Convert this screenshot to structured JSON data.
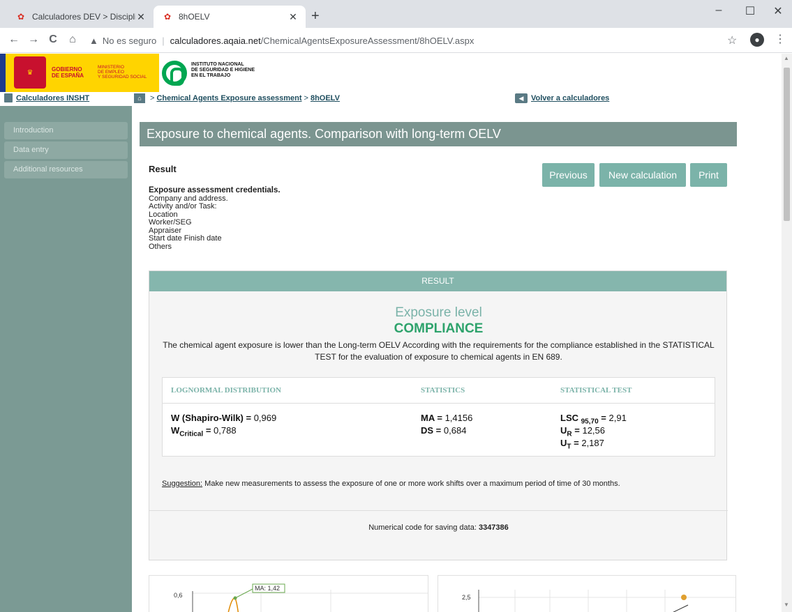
{
  "browser": {
    "tabs": [
      {
        "title": "Calculadores DEV > Disciplinas > ",
        "active": false
      },
      {
        "title": "8hOELV",
        "active": true
      }
    ],
    "new_tab": "+",
    "window_controls": {
      "minimize": "–",
      "maximize": "☐",
      "close": "✕"
    },
    "nav": {
      "back": "←",
      "forward": "→",
      "reload": "C",
      "home": "⌂"
    },
    "address": {
      "security": "No es seguro",
      "host": "calculadores.aqaia.net",
      "path": "/ChemicalAgentsExposureAssessment/8hOELV.aspx"
    }
  },
  "banner": {
    "gobierno": "GOBIERNO\nDE ESPAÑA",
    "ministerio": "MINISTERIO\nDE EMPLEO\nY SEGURIDAD SOCIAL",
    "insht": "INSTITUTO NACIONAL\nDE SEGURIDAD E HIGIENE\nEN EL TRABAJO"
  },
  "breadcrumb": {
    "calculadores": "Calculadores INSHT",
    "sep": ">",
    "level1": "Chemical Agents Exposure assessment",
    "level2": "8hOELV",
    "back": "Volver a calculadores"
  },
  "sidebar": {
    "items": [
      {
        "label": "Introduction"
      },
      {
        "label": "Data entry"
      },
      {
        "label": "Additional resources"
      }
    ]
  },
  "main": {
    "heading": "Exposure to chemical agents. Comparison with long-term OELV",
    "result_title": "Result",
    "buttons": {
      "previous": "Previous",
      "new_calc": "New calculation",
      "print": "Print"
    },
    "credentials": {
      "title": "Exposure assessment credentials.",
      "lines": [
        "Company and address.",
        "Activity and/or Task:",
        "Location",
        "Worker/SEG",
        "Appraiser",
        "Start date Finish date",
        "Others"
      ]
    },
    "result": {
      "header": "RESULT",
      "exposure_level": "Exposure level",
      "verdict": "COMPLIANCE",
      "description": "The chemical agent exposure is lower than the Long-term OELV According with the requirements for the compliance established in the STATISTICAL TEST for the evaluation of exposure to chemical agents in EN 689.",
      "columns": [
        "LOGNORMAL DISTRIBUTION",
        "STATISTICS",
        "STATISTICAL TEST"
      ],
      "w_label": "W (Shapiro-Wilk) =",
      "w_value": "0,969",
      "wcrit_label": "W",
      "wcrit_sub": "Critical",
      "wcrit_value": "0,788",
      "ma_label": "MA =",
      "ma_value": "1,4156",
      "ds_label": "DS =",
      "ds_value": "0,684",
      "lsc_label": "LSC",
      "lsc_sub": "95,70",
      "lsc_value": "2,91",
      "ur_label": "U",
      "ur_sub": "R",
      "ur_value": "12,56",
      "ut_label": "U",
      "ut_sub": "T",
      "ut_value": "2,187",
      "suggestion_label": "Suggestion:",
      "suggestion_text": " Make new measurements to assess the exposure of one or more work shifts over a maximum period of time of 30 months.",
      "numcode_label": "Numerical code for saving data: ",
      "numcode_value": "3347386"
    }
  },
  "charts": {
    "left": {
      "ytick": "0,6",
      "annotation": "MA: 1,42"
    },
    "right": {
      "ytick": "2,5"
    }
  },
  "colors": {
    "accent": "#7bb3a9",
    "header": "#7b9590",
    "compliance": "#2ea36c",
    "sidebar": "#7b9a94"
  }
}
